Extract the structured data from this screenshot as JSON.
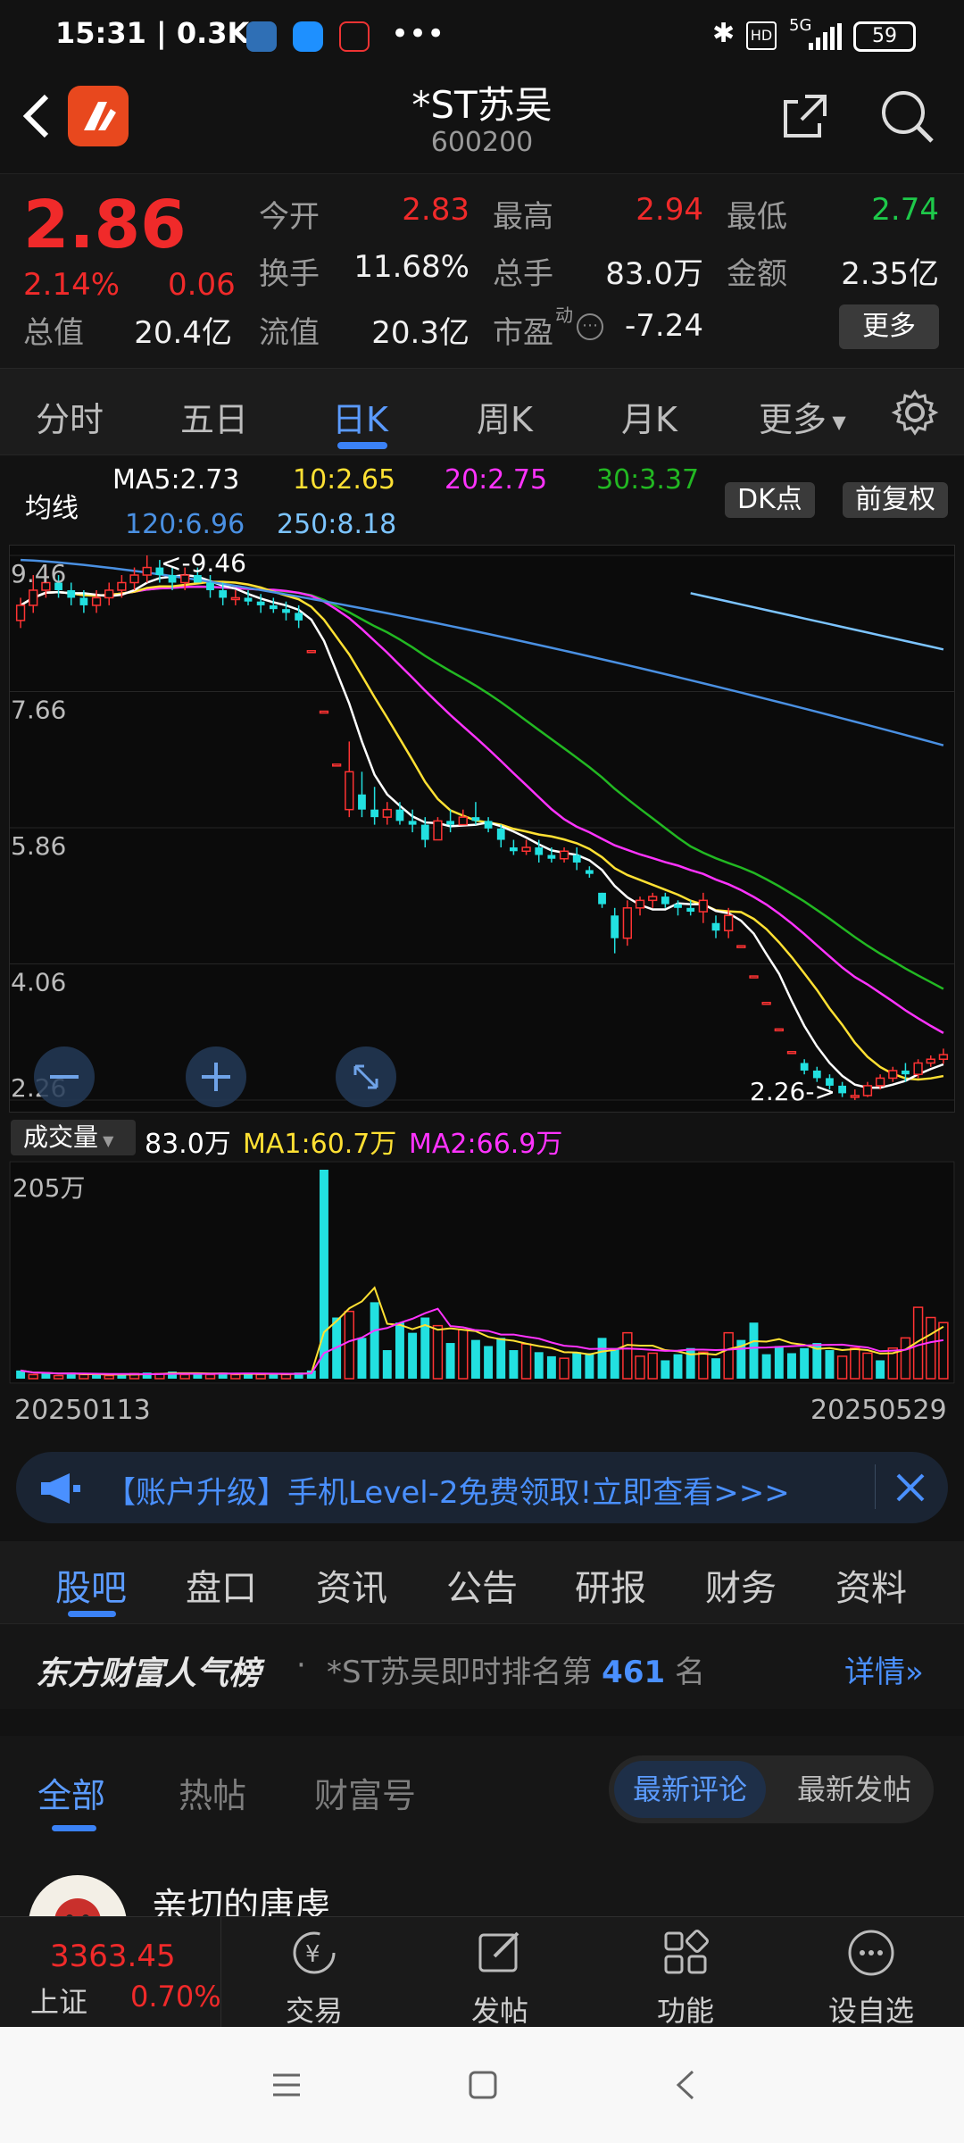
{
  "status_bar": {
    "time": "15:31 | 0.3K/s",
    "signal": "5G",
    "battery": "59"
  },
  "header": {
    "title": "*ST苏吴",
    "code": "600200"
  },
  "quote": {
    "price": "2.86",
    "change_pct": "2.14%",
    "change": "0.06",
    "rows": [
      [
        {
          "label": "今开",
          "value": "2.83",
          "color": "red"
        },
        {
          "label": "最高",
          "value": "2.94",
          "color": "red"
        },
        {
          "label": "最低",
          "value": "2.74",
          "color": "green"
        }
      ],
      [
        {
          "label": "换手",
          "value": "11.68%",
          "color": "white"
        },
        {
          "label": "总手",
          "value": "83.0万",
          "color": "white"
        },
        {
          "label": "金额",
          "value": "2.35亿",
          "color": "white"
        }
      ]
    ],
    "total_value_label": "总值",
    "total_value": "20.4亿",
    "float_value_label": "流值",
    "float_value": "20.3亿",
    "pe_label": "市盈",
    "pe_sup": "动",
    "pe_value": "-7.24",
    "more_label": "更多"
  },
  "period_tabs": {
    "items": [
      "分时",
      "五日",
      "日K",
      "周K",
      "月K",
      "更多"
    ],
    "active_index": 2
  },
  "ma_legend": {
    "label": "均线",
    "ma5": "MA5:2.73",
    "ma10": "10:2.65",
    "ma20": "20:2.75",
    "ma30": "30:3.37",
    "ma120": "120:6.96",
    "ma250": "250:8.18",
    "dk_button": "DK点",
    "adjust_button": "前复权",
    "colors": {
      "ma5": "#ffffff",
      "ma10": "#ffe033",
      "ma20": "#ff33ff",
      "ma30": "#22b822",
      "ma120": "#4a90e2",
      "ma250": "#7cc4ff"
    }
  },
  "kline": {
    "y_ticks": [
      "9.46",
      "7.66",
      "5.86",
      "4.06",
      "2.26"
    ],
    "high_annotation": "<-9.46",
    "low_annotation": "2.26->"
  },
  "volume": {
    "selector_label": "成交量",
    "value": "83.0万",
    "ma1": "MA1:60.7万",
    "ma2": "MA2:66.9万",
    "y_tick": "205万",
    "start_date": "20250113",
    "end_date": "20250529"
  },
  "chart_data": {
    "type": "candlestick",
    "title": "*ST苏吴 日K",
    "x": [
      "20250113",
      "20250529"
    ],
    "ylim": [
      2.26,
      9.46
    ],
    "y_ticks": [
      9.46,
      7.66,
      5.86,
      4.06,
      2.26
    ],
    "ohlc_approx": [
      [
        8.6,
        8.9,
        8.5,
        8.8
      ],
      [
        8.8,
        9.2,
        8.7,
        9.0
      ],
      [
        9.0,
        9.3,
        8.9,
        9.1
      ],
      [
        9.1,
        9.2,
        8.9,
        9.0
      ],
      [
        9.0,
        9.1,
        8.8,
        8.9
      ],
      [
        8.9,
        9.0,
        8.7,
        8.8
      ],
      [
        8.8,
        9.0,
        8.7,
        8.9
      ],
      [
        8.9,
        9.1,
        8.8,
        9.0
      ],
      [
        9.0,
        9.2,
        8.9,
        9.1
      ],
      [
        9.1,
        9.3,
        9.0,
        9.2
      ],
      [
        9.2,
        9.46,
        9.1,
        9.3
      ],
      [
        9.3,
        9.4,
        9.1,
        9.2
      ],
      [
        9.2,
        9.3,
        9.0,
        9.1
      ],
      [
        9.1,
        9.3,
        9.0,
        9.2
      ],
      [
        9.2,
        9.3,
        9.1,
        9.1
      ],
      [
        9.1,
        9.2,
        8.9,
        9.0
      ],
      [
        9.0,
        9.1,
        8.8,
        8.9
      ],
      [
        8.9,
        9.0,
        8.8,
        8.9
      ],
      [
        8.9,
        9.0,
        8.8,
        8.85
      ],
      [
        8.85,
        8.95,
        8.7,
        8.8
      ],
      [
        8.8,
        8.9,
        8.7,
        8.75
      ],
      [
        8.75,
        8.85,
        8.6,
        8.7
      ],
      [
        8.7,
        8.8,
        8.5,
        8.6
      ],
      [
        8.2,
        8.2,
        8.2,
        8.2
      ],
      [
        7.4,
        7.4,
        7.4,
        7.4
      ],
      [
        6.7,
        6.7,
        6.7,
        6.7
      ],
      [
        6.1,
        7.0,
        6.0,
        6.6
      ],
      [
        6.3,
        6.6,
        6.0,
        6.1
      ],
      [
        6.1,
        6.4,
        5.9,
        6.0
      ],
      [
        6.0,
        6.2,
        5.9,
        6.1
      ],
      [
        6.1,
        6.2,
        5.9,
        5.95
      ],
      [
        5.95,
        6.1,
        5.8,
        5.9
      ],
      [
        5.9,
        6.0,
        5.6,
        5.7
      ],
      [
        5.7,
        6.0,
        5.7,
        5.95
      ],
      [
        5.95,
        6.1,
        5.8,
        5.9
      ],
      [
        5.9,
        6.1,
        5.9,
        6.0
      ],
      [
        6.0,
        6.2,
        5.9,
        5.95
      ],
      [
        5.95,
        6.0,
        5.8,
        5.85
      ],
      [
        5.85,
        5.9,
        5.6,
        5.7
      ],
      [
        5.6,
        5.7,
        5.5,
        5.55
      ],
      [
        5.55,
        5.7,
        5.5,
        5.6
      ],
      [
        5.6,
        5.7,
        5.4,
        5.5
      ],
      [
        5.5,
        5.6,
        5.4,
        5.45
      ],
      [
        5.45,
        5.6,
        5.4,
        5.55
      ],
      [
        5.5,
        5.6,
        5.3,
        5.4
      ],
      [
        5.3,
        5.35,
        5.2,
        5.25
      ],
      [
        5.0,
        5.0,
        4.8,
        4.85
      ],
      [
        4.7,
        4.8,
        4.2,
        4.4
      ],
      [
        4.4,
        4.9,
        4.3,
        4.8
      ],
      [
        4.8,
        4.95,
        4.7,
        4.9
      ],
      [
        4.9,
        5.0,
        4.8,
        4.95
      ],
      [
        4.95,
        5.0,
        4.8,
        4.85
      ],
      [
        4.85,
        4.9,
        4.7,
        4.8
      ],
      [
        4.8,
        4.9,
        4.7,
        4.75
      ],
      [
        4.75,
        5.0,
        4.6,
        4.9
      ],
      [
        4.6,
        4.7,
        4.4,
        4.5
      ],
      [
        4.5,
        4.8,
        4.4,
        4.7
      ],
      [
        4.3,
        4.3,
        4.3,
        4.3
      ],
      [
        3.9,
        3.9,
        3.9,
        3.9
      ],
      [
        3.55,
        3.55,
        3.55,
        3.55
      ],
      [
        3.2,
        3.2,
        3.2,
        3.2
      ],
      [
        2.9,
        2.9,
        2.9,
        2.9
      ],
      [
        2.75,
        2.8,
        2.6,
        2.65
      ],
      [
        2.65,
        2.7,
        2.5,
        2.55
      ],
      [
        2.55,
        2.6,
        2.4,
        2.45
      ],
      [
        2.45,
        2.5,
        2.3,
        2.35
      ],
      [
        2.3,
        2.4,
        2.26,
        2.32
      ],
      [
        2.32,
        2.5,
        2.3,
        2.45
      ],
      [
        2.45,
        2.6,
        2.4,
        2.55
      ],
      [
        2.55,
        2.7,
        2.5,
        2.65
      ],
      [
        2.65,
        2.75,
        2.5,
        2.6
      ],
      [
        2.6,
        2.8,
        2.55,
        2.75
      ],
      [
        2.75,
        2.85,
        2.7,
        2.8
      ],
      [
        2.8,
        2.94,
        2.74,
        2.86
      ]
    ],
    "volume_ymax": 205,
    "volume_unit": "万",
    "volume": [
      8,
      4,
      5,
      3,
      6,
      4,
      4,
      3,
      4,
      5,
      6,
      5,
      7,
      4,
      5,
      4,
      6,
      4,
      5,
      4,
      5,
      4,
      6,
      8,
      205,
      60,
      66,
      40,
      75,
      28,
      55,
      45,
      60,
      52,
      35,
      48,
      38,
      32,
      40,
      28,
      34,
      26,
      22,
      20,
      26,
      25,
      40,
      30,
      45,
      22,
      25,
      18,
      24,
      30,
      26,
      20,
      45,
      38,
      55,
      24,
      32,
      25,
      30,
      35,
      28,
      22,
      30,
      25,
      18,
      30,
      40,
      70,
      60,
      55
    ],
    "volume_up": [
      false,
      true,
      false,
      true,
      false,
      true,
      false,
      true,
      false,
      true,
      false,
      true,
      false,
      true,
      false,
      true,
      false,
      true,
      false,
      true,
      false,
      true,
      false,
      false,
      false,
      false,
      true,
      false,
      false,
      false,
      false,
      false,
      false,
      true,
      false,
      true,
      false,
      false,
      false,
      false,
      true,
      false,
      false,
      true,
      false,
      false,
      false,
      false,
      true,
      true,
      true,
      false,
      false,
      false,
      true,
      false,
      true,
      false,
      false,
      false,
      false,
      false,
      false,
      false,
      false,
      true,
      true,
      true,
      false,
      true,
      true,
      true,
      true,
      true
    ],
    "ma_lines": {
      "MA5": {
        "color": "#ffffff",
        "last": 2.73
      },
      "MA10": {
        "color": "#ffe033",
        "last": 2.65
      },
      "MA20": {
        "color": "#ff33ff",
        "last": 2.75
      },
      "MA30": {
        "color": "#22b822",
        "last": 3.37
      },
      "MA120": {
        "color": "#4a90e2",
        "last": 6.96
      },
      "MA250": {
        "color": "#7cc4ff",
        "last": 8.18
      }
    }
  },
  "banner": {
    "text": "【账户升级】手机Level-2免费领取!立即查看>>>"
  },
  "sub_tabs": {
    "items": [
      "股吧",
      "盘口",
      "资讯",
      "公告",
      "研报",
      "财务",
      "资料"
    ],
    "active_index": 0
  },
  "rank_bar": {
    "brand": "东方财富人气榜",
    "separator": "·",
    "text_prefix": "*ST苏吴即时排名第",
    "rank": "461",
    "text_suffix": "名",
    "detail": "详情"
  },
  "feed_tabs": {
    "items": [
      "全部",
      "热帖",
      "财富号"
    ],
    "active_index": 0,
    "toggle_on": "最新评论",
    "toggle_off": "最新发帖"
  },
  "post": {
    "author": "亲切的唐虔"
  },
  "bottom_nav": {
    "index_value": "3363.45",
    "index_name": "上证",
    "index_change": "0.70%",
    "items": [
      {
        "label": "交易",
        "icon": "trade-icon"
      },
      {
        "label": "发帖",
        "icon": "compose-icon"
      },
      {
        "label": "功能",
        "icon": "grid-icon"
      },
      {
        "label": "设自选",
        "icon": "more-circle-icon"
      }
    ]
  }
}
